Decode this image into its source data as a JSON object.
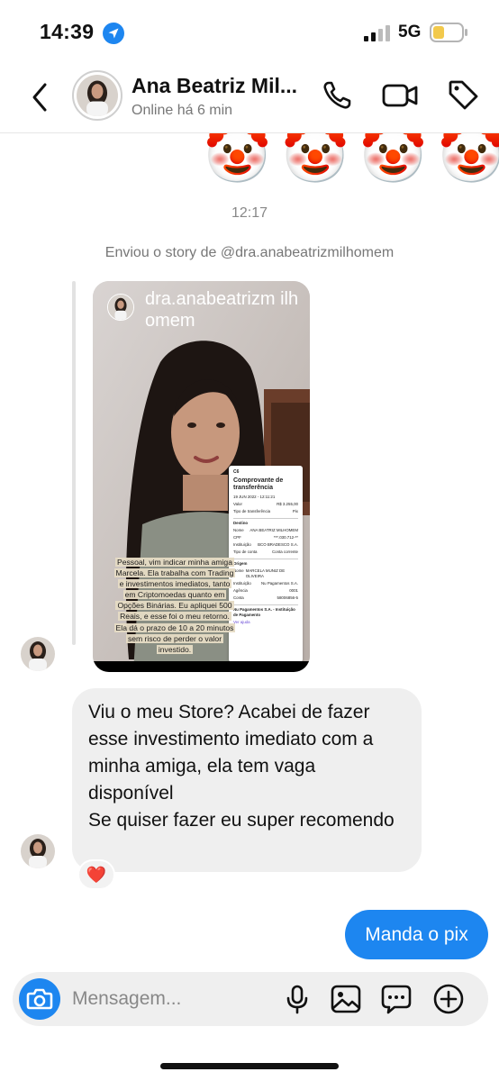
{
  "status_bar": {
    "time": "14:39",
    "network": "5G",
    "icons": [
      "location-arrow-icon",
      "signal-bars-icon",
      "battery-icon"
    ],
    "battery_color": "#f2c94c"
  },
  "header": {
    "contact_name": "Ana Beatriz Mil...",
    "contact_status": "Online há 6 min",
    "icons": [
      "back-chevron-icon",
      "phone-icon",
      "video-camera-icon",
      "tag-icon"
    ]
  },
  "messages": {
    "reaction_emojis": "🤡🤡🤡🤡",
    "time_divider": "12:17",
    "story_caption": "Enviou o story de @dra.anabeatrizmilhomem",
    "story": {
      "username": "dra.anabeatrizm ilhomem",
      "overlay_text": "Pessoal, vim indicar minha amiga Marcela. Ela trabalha com Trading e investimentos imediatos, tanto em Criptomoedas quanto em Opções Binárias. Eu apliquei 500 Reais, e esse foi o meu retorno. Ela dá o prazo de 10 a 20 minutos sem risco de perder o valor investido.",
      "receipt": {
        "logo": "C6",
        "title": "Comprovante de transferência",
        "date": "19 JUN 2022 - 12:11:21",
        "rows": [
          {
            "k": "Valor",
            "v": "R$ 3.255,00"
          },
          {
            "k": "Tipo de transferência",
            "v": "Pix"
          }
        ],
        "destino_label": "Destino",
        "destino_rows": [
          {
            "k": "Nome",
            "v": "ANA BEATRIZ MILHOMEM"
          },
          {
            "k": "CPF",
            "v": "***.030.712-**"
          },
          {
            "k": "Instituição",
            "v": "BCO BRADESCO S.A."
          },
          {
            "k": "Tipo de conta",
            "v": "Conta corrente"
          }
        ],
        "origem_label": "Origem",
        "origem_rows": [
          {
            "k": "Nome",
            "v": "MARCELA MUNIZ DE OLIVEIRA"
          },
          {
            "k": "Instituição",
            "v": "Nu Pagamentos S.A."
          },
          {
            "k": "Agência",
            "v": "0001"
          },
          {
            "k": "Conta",
            "v": "58006856-5"
          }
        ],
        "footer": "Nu Pagamentos S.A. - Instituição de Pagamento",
        "link": "Ver ajuda"
      }
    },
    "incoming_message": {
      "line1": "Viu o meu Store? Acabei de fazer esse investimento imediato com a minha amiga, ela tem vaga disponível",
      "line2": "Se quiser fazer eu super recomendo",
      "reaction": "❤️"
    },
    "outgoing_message": "Manda o pix"
  },
  "composer": {
    "placeholder": "Mensagem...",
    "icons": [
      "camera-icon",
      "microphone-icon",
      "image-icon",
      "chat-bubble-icon",
      "plus-circle-icon"
    ],
    "accent": "#1d86f0"
  }
}
